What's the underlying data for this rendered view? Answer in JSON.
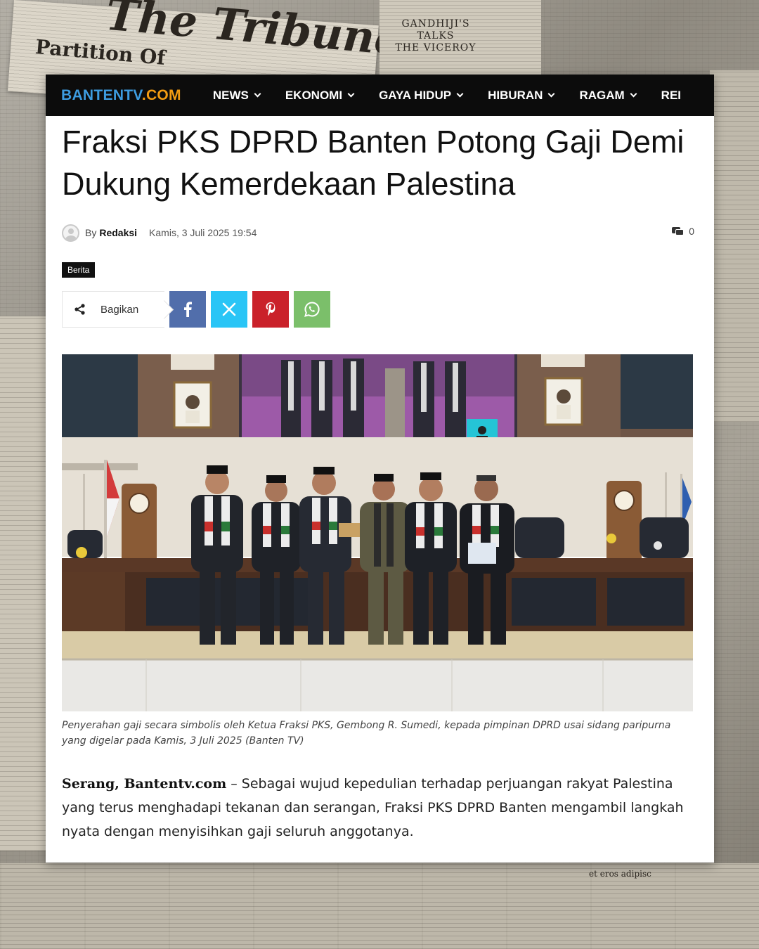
{
  "background": {
    "masthead": "The Tribune",
    "partition_headline": "Partition Of",
    "side_headline": [
      "GANDHIJI'S TALKS",
      "THE VICEROY"
    ],
    "latin_snippet": "et eros adipisc"
  },
  "site": {
    "logo_part1": "BANTENTV",
    "logo_part2": ".COM",
    "colors": {
      "logo_blue": "#3d9ce0",
      "logo_orange": "#f39c12",
      "nav_bg": "#0c0c0c"
    }
  },
  "nav": {
    "items": [
      "NEWS",
      "EKONOMI",
      "GAYA HIDUP",
      "HIBURAN",
      "RAGAM",
      "REI"
    ]
  },
  "article": {
    "title": "Fraksi PKS DPRD Banten Potong Gaji Demi Dukung Kemerdekaan Palestina",
    "by_label": "By",
    "author": "Redaksi",
    "date": "Kamis, 3 Juli 2025 19:54",
    "comment_count": "0",
    "category_tag": "Berita",
    "caption": "Penyerahan gaji secara simbolis oleh Ketua Fraksi PKS, Gembong R. Sumedi, kepada pimpinan DPRD usai sidang paripurna yang digelar pada Kamis, 3 Juli 2025 (Banten TV)",
    "dateline": "Serang, Bantentv.com",
    "lead": " – Sebagai wujud kepedulian terhadap perjuangan rakyat Palestina yang terus menghadapi tekanan dan serangan, Fraksi PKS DPRD Banten mengambil langkah nyata dengan menyisihkan gaji seluruh anggotanya."
  },
  "share": {
    "label": "Bagikan",
    "buttons": [
      {
        "name": "facebook-icon",
        "color": "#516eab"
      },
      {
        "name": "x-twitter-icon",
        "color": "#29c5f6"
      },
      {
        "name": "pinterest-icon",
        "color": "#ca212a"
      },
      {
        "name": "whatsapp-icon",
        "color": "#7bbf6a"
      }
    ]
  }
}
